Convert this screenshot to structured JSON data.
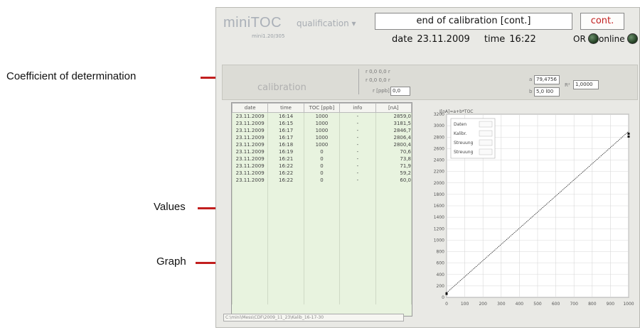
{
  "annotations": {
    "coefficient": "Coefficient of determination",
    "values": "Values",
    "graph": "Graph",
    "arrow_color": "#c21f1f"
  },
  "app": {
    "brand": "miniTOC",
    "brand_sub": "mini1.20/305",
    "mode": "qualification ▾",
    "status": "end of calibration [cont.]",
    "cont_button": "cont.",
    "date_label": "date",
    "date_value": "23.11.2009",
    "time_label": "time",
    "time_value": "16:22",
    "or_label": "OR",
    "online_label": "online",
    "led_color": "#2f5a2f"
  },
  "calibration": {
    "label": "calibration",
    "r1": "r   0,0     0,0 r",
    "r2": "r   0,0     0,0 r",
    "r_ppb_label": "r [ppb]",
    "r_ppb_value": "0,0",
    "a_label": "a",
    "a_value": "79,4756",
    "b_label": "b",
    "b_value": "5,0 l00",
    "r2_label": "R²",
    "r2_value": "1,0000"
  },
  "table": {
    "headers": [
      "date",
      "time",
      "TOC [ppb]",
      "info",
      "[nA]"
    ],
    "rows": [
      [
        "23.11.2009",
        "16:14",
        "1000",
        "-",
        "2859,0"
      ],
      [
        "23.11.2009",
        "16:15",
        "1000",
        "-",
        "3181,5"
      ],
      [
        "23.11.2009",
        "16:17",
        "1000",
        "-",
        "2846,7"
      ],
      [
        "23.11.2009",
        "16:17",
        "1000",
        "-",
        "2806,4"
      ],
      [
        "23.11.2009",
        "16:18",
        "1000",
        "-",
        "2800,4"
      ],
      [
        "23.11.2009",
        "16:19",
        "0",
        "-",
        "70,6"
      ],
      [
        "23.11.2009",
        "16:21",
        "0",
        "-",
        "73,8"
      ],
      [
        "23.11.2009",
        "16:22",
        "0",
        "-",
        "71,9"
      ],
      [
        "23.11.2009",
        "16:22",
        "0",
        "-",
        "59,2"
      ],
      [
        "23.11.2009",
        "16:22",
        "0",
        "-",
        "60,0"
      ]
    ]
  },
  "chart_data": {
    "type": "scatter",
    "title": "I[nA]≈a+b*TOC",
    "xlim": [
      0,
      1000
    ],
    "ylim": [
      0,
      3200
    ],
    "x_ticks": [
      "0",
      "100",
      "200",
      "300",
      "400",
      "500",
      "600",
      "700",
      "800",
      "900",
      "1000"
    ],
    "y_ticks": [
      "0",
      "200",
      "400",
      "600",
      "800",
      "1000",
      "1200",
      "1400",
      "1600",
      "1800",
      "2000",
      "2200",
      "2400",
      "2600",
      "2800",
      "3000",
      "3200"
    ],
    "legend": [
      "Daten",
      "Kalibr.",
      "Streuung",
      "Streuung"
    ],
    "points": [
      {
        "x": 0,
        "y": 60
      },
      {
        "x": 0,
        "y": 70
      },
      {
        "x": 1000,
        "y": 2860
      },
      {
        "x": 1000,
        "y": 2810
      }
    ],
    "fit_line": {
      "x": [
        0,
        1000
      ],
      "y": [
        80,
        2900
      ]
    },
    "grid": true
  },
  "footer": "C:\\mini\\Mess\\CDF\\2009_11_23\\Kalib_16-17-30"
}
